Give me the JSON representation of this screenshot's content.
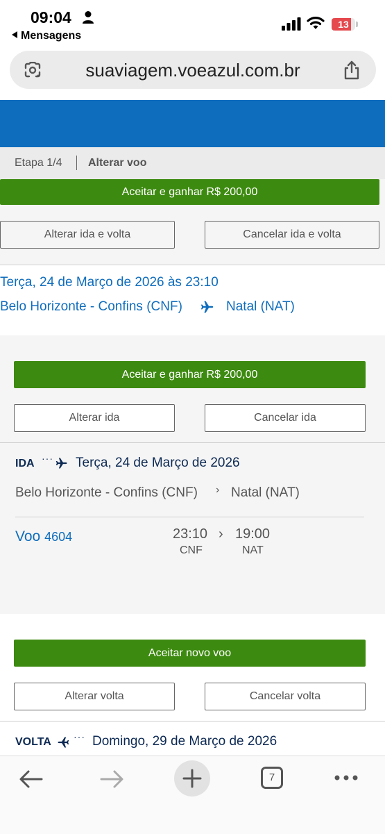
{
  "status_bar": {
    "time": "09:04",
    "back_app": "Mensagens",
    "battery_level": "13"
  },
  "browser": {
    "url": "suaviagem.voeazul.com.br"
  },
  "step_bar": {
    "step": "Etapa 1/4",
    "action": "Alterar voo"
  },
  "top_actions": {
    "accept_label": "Aceitar e ganhar R$ 200,00",
    "change_roundtrip": "Alterar ida e volta",
    "cancel_roundtrip": "Cancelar ida e volta"
  },
  "summary": {
    "datetime": "Terça, 24 de Março de 2026 às 23:10",
    "origin": "Belo Horizonte - Confins (CNF)",
    "destination": "Natal (NAT)"
  },
  "ida_actions": {
    "accept_label": "Aceitar e ganhar R$ 200,00",
    "change": "Alterar ida",
    "cancel": "Cancelar ida"
  },
  "ida": {
    "tag": "IDA",
    "date": "Terça, 24 de Março de 2026",
    "origin": "Belo Horizonte - Confins (CNF)",
    "destination": "Natal (NAT)",
    "flight_prefix": "Voo",
    "flight_number": "4604",
    "depart_time": "23:10",
    "depart_code": "CNF",
    "arrive_time": "19:00",
    "arrive_code": "NAT"
  },
  "volta_actions": {
    "accept_label": "Aceitar novo voo",
    "change": "Alterar volta",
    "cancel": "Cancelar volta"
  },
  "volta": {
    "tag": "VOLTA",
    "date": "Domingo, 29 de Março de 2026"
  },
  "bottom_nav": {
    "tab_count": "7"
  },
  "colors": {
    "brand_blue": "#0f6dbd",
    "accept_green": "#3d8a10",
    "battery_red": "#e5484d"
  }
}
